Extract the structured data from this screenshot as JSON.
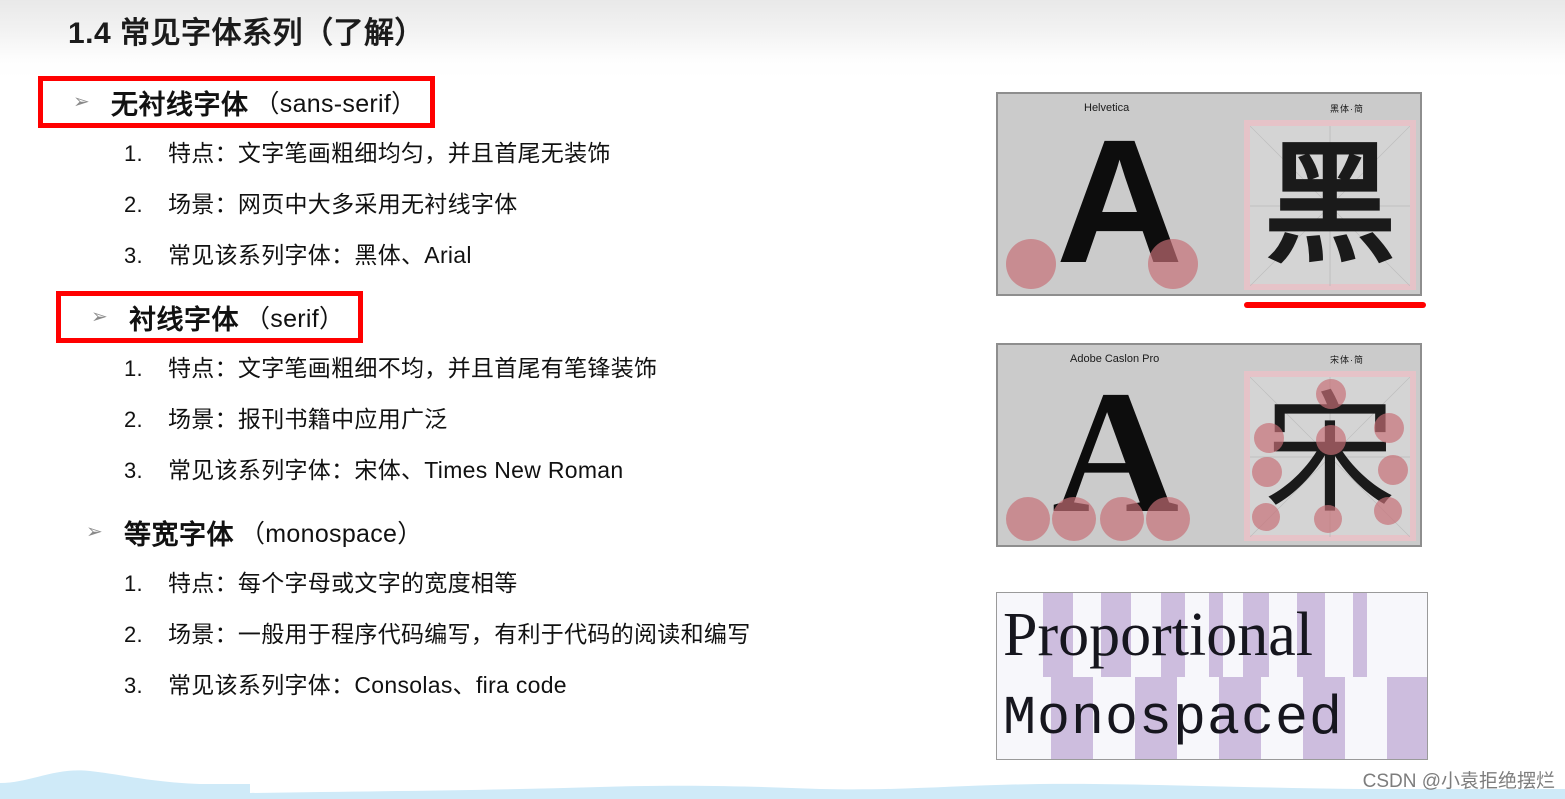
{
  "slide": {
    "title": "1.4 常见字体系列（了解）",
    "watermark": "CSDN @小袁拒绝摆烂",
    "accent_red": "#ff0000",
    "marker_glyph": "➢"
  },
  "sections": [
    {
      "heading_cn": "无衬线字体",
      "heading_en": "（sans-serif）",
      "boxed": true,
      "items": [
        {
          "num": "1.",
          "text": "特点：文字笔画粗细均匀，并且首尾无装饰"
        },
        {
          "num": "2.",
          "text": "场景：网页中大多采用无衬线字体"
        },
        {
          "num": "3.",
          "text": "常见该系列字体：黑体、Arial"
        }
      ]
    },
    {
      "heading_cn": "衬线字体",
      "heading_en": "（serif）",
      "boxed": true,
      "items": [
        {
          "num": "1.",
          "text": "特点：文字笔画粗细不均，并且首尾有笔锋装饰"
        },
        {
          "num": "2.",
          "text": "场景：报刊书籍中应用广泛"
        },
        {
          "num": "3.",
          "text": "常见该系列字体：宋体、Times New Roman"
        }
      ]
    },
    {
      "heading_cn": "等宽字体",
      "heading_en": "（monospace）",
      "boxed": false,
      "items": [
        {
          "num": "1.",
          "text": "特点：每个字母或文字的宽度相等"
        },
        {
          "num": "2.",
          "text": "场景：一般用于程序代码编写，有利于代码的阅读和编写"
        },
        {
          "num": "3.",
          "text": "常见该系列字体：Consolas、fira code"
        }
      ]
    }
  ],
  "figures": {
    "sans": {
      "latin_label": "Helvetica",
      "latin_letter": "A",
      "cjk_label": "黑体·简",
      "cjk_char": "黑",
      "marker_color": "#c76e76"
    },
    "serif": {
      "latin_label": "Adobe Caslon Pro",
      "latin_letter": "A",
      "cjk_label": "宋体·简",
      "cjk_char": "宋",
      "marker_color": "#c76e76"
    },
    "mono": {
      "proportional_word": "Proportional",
      "monospaced_word": "Monospaced",
      "stripe_color": "#c5b3d8"
    }
  }
}
